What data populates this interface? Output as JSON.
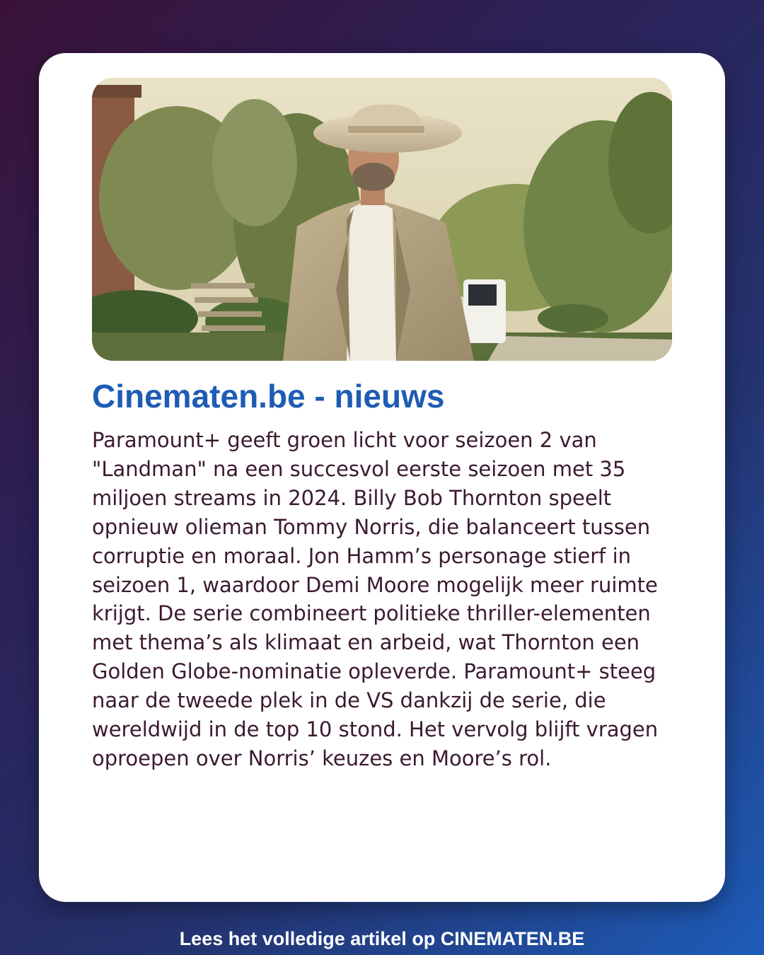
{
  "card": {
    "headline": "Cinematen.be - nieuws",
    "body": "Paramount+ geeft groen licht voor seizoen 2 van \"Landman\" na een succesvol eerste seizoen met 35 miljoen streams in 2024. Billy Bob Thornton speelt opnieuw olieman Tommy Norris, die balanceert tussen corruptie en moraal. Jon Hamm’s personage stierf in seizoen 1, waardoor Demi Moore mogelijk meer ruimte krijgt. De serie combineert politieke thriller-elementen met thema’s als klimaat en arbeid, wat Thornton een Golden Globe-nominatie opleverde. Paramount+ steeg naar de tweede plek in de VS dankzij de serie, die wereldwijd in de top 10 stond. Het vervolg blijft vragen oproepen over Norris’ keuzes en Moore’s rol."
  },
  "footer": {
    "cta": "Lees het volledige artikel op CINEMATEN.BE"
  },
  "colors": {
    "headline": "#1f5cb3",
    "body_text": "#3b1a30",
    "background_start": "#3a1238",
    "background_end": "#1d5cb8"
  }
}
